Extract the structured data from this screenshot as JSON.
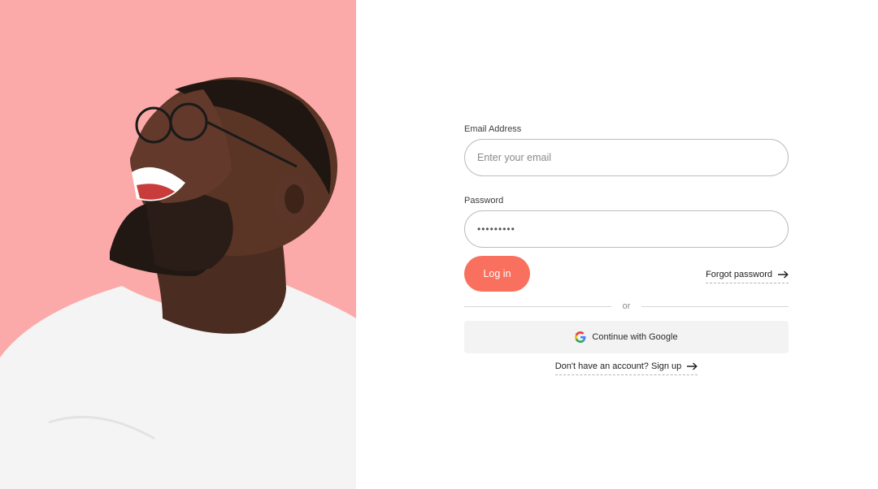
{
  "hero": {
    "image": "laughing-man-photo",
    "background_color": "#fbaaa9"
  },
  "form": {
    "email": {
      "label": "Email Address",
      "placeholder": "Enter your email"
    },
    "password": {
      "label": "Password",
      "value": "•••••••••"
    },
    "login_label": "Log in",
    "forgot_label": "Forgot password",
    "divider_label": "or",
    "google_label": "Continue with Google",
    "signup_label": "Don't have an account? Sign up"
  },
  "colors": {
    "accent": "#f9705e",
    "input_border": "#bdbdbd",
    "google_button_bg": "#f3f3f3"
  },
  "icons": {
    "arrow": "arrow-right-icon",
    "google": "google-icon"
  }
}
